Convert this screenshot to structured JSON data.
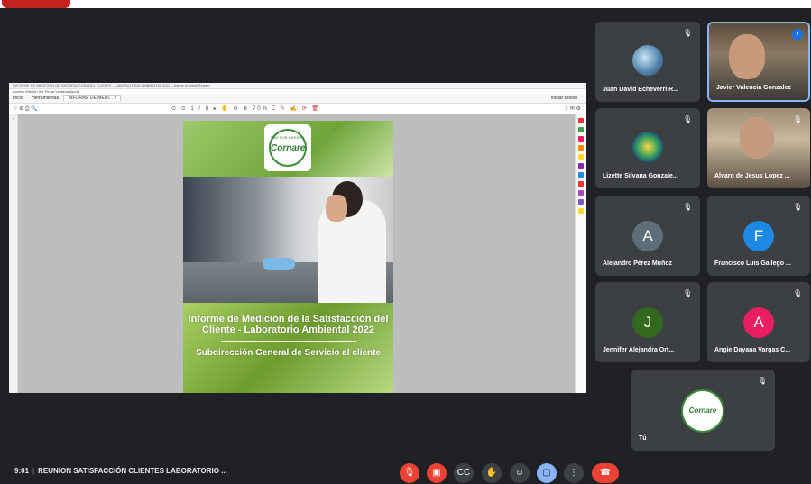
{
  "pdf_window": {
    "title": "INFORME DE MEDICIÓN DE SATISFACCIÓN DEL CLIENTE - LABORATORIO AMBIENTAL 2022 - Adobe Acrobat Reader",
    "menu": "Archivo  Edición  Ver  Firma  Ventana  Ayuda",
    "tabs": [
      "Inicio",
      "Herramientas",
      "INFORME DE MEDI... ×"
    ],
    "signin": "Iniciar sesión",
    "zoom": "70%",
    "page_counter": "1 / 8"
  },
  "document": {
    "logo_arc_text": "MÁS POR NATURAL",
    "logo_brand": "Cornare",
    "title": "Informe de Medición de la Satisfacción del Cliente - Laboratorio Ambiental 2022",
    "subtitle": "Subdirección General de Servicio al cliente"
  },
  "participants": [
    {
      "name": "Juan David Echeverri R...",
      "muted": true
    },
    {
      "name": "Javier Valencia Gonzalez",
      "speaking": true
    },
    {
      "name": "Lizette Silvana Gonzale...",
      "muted": true
    },
    {
      "name": "Alvaro de Jesus Lopez ...",
      "muted": true
    },
    {
      "name": "Alejandro Pérez Muñoz",
      "initial": "A",
      "color": "#5f6f7a",
      "muted": true
    },
    {
      "name": "Francisco Luis Gallego ...",
      "initial": "F",
      "color": "#1e88e5",
      "muted": true
    },
    {
      "name": "Jennifer Alejandra Ort...",
      "initial": "J",
      "color": "#33691e",
      "muted": true
    },
    {
      "name": "Angie Dayana Vargas C...",
      "initial": "A",
      "color": "#e91e63",
      "muted": true
    },
    {
      "name": "Tú",
      "muted": true
    }
  ],
  "meeting": {
    "time": "9:01",
    "name": "REUNION SATISFACCIÓN CLIENTES LABORATORIO ..."
  },
  "controls": [
    "mic-off",
    "camera-off",
    "captions",
    "raise-hand",
    "emoji",
    "present",
    "more",
    "end-call"
  ]
}
